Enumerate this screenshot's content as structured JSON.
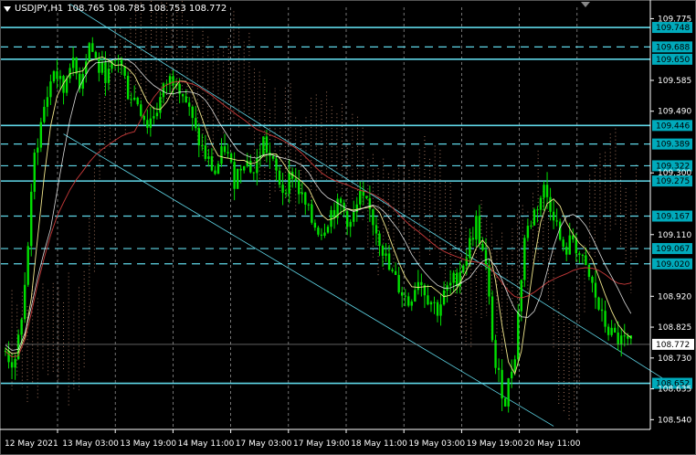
{
  "symbol_header": {
    "symbol": "USDJPY,H1",
    "ohlc": "108.765 108.785 108.753 108.772",
    "dropdown_icon": "triangle-down-icon"
  },
  "colors": {
    "background": "#000000",
    "candle": "#00e000",
    "level_line": "#5fd7e8",
    "level_label_bg": "#00aabb",
    "price_axis_text": "#ffffff",
    "grid": "#cfcfcf",
    "ma_white": "#ffffff",
    "ma_red": "#c83a3a",
    "ma_yellow": "#f0e68c",
    "cloud_dots": "#e0a080"
  },
  "price_axis": {
    "ticks": [
      "109.775",
      "109.585",
      "109.490",
      "109.300",
      "109.110",
      "108.920",
      "108.825",
      "108.730",
      "108.635",
      "108.540"
    ],
    "current_price": "108.772"
  },
  "levels": [
    {
      "price": "109.748",
      "style": "solid"
    },
    {
      "price": "109.688",
      "style": "dashed"
    },
    {
      "price": "109.650",
      "style": "solid"
    },
    {
      "price": "109.446",
      "style": "solid"
    },
    {
      "price": "109.389",
      "style": "dashed"
    },
    {
      "price": "109.322",
      "style": "dashed"
    },
    {
      "price": "109.275",
      "style": "solid"
    },
    {
      "price": "109.167",
      "style": "dashed"
    },
    {
      "price": "109.067",
      "style": "dashed"
    },
    {
      "price": "109.020",
      "style": "dashed"
    },
    {
      "price": "108.652",
      "style": "solid"
    }
  ],
  "time_axis": {
    "labels": [
      "12 May 2021",
      "13 May 03:00",
      "13 May 19:00",
      "14 May 11:00",
      "17 May 03:00",
      "17 May 19:00",
      "18 May 11:00",
      "19 May 03:00",
      "19 May 19:00",
      "20 May 11:00"
    ]
  },
  "chart_data": {
    "type": "candlestick",
    "title": "USDJPY,H1",
    "ylim": [
      108.51,
      109.81
    ],
    "horizontal_levels": [
      109.748,
      109.688,
      109.65,
      109.446,
      109.389,
      109.322,
      109.275,
      109.167,
      109.067,
      109.02,
      108.652
    ],
    "last_price": 108.772,
    "grid": true,
    "close_path": [
      [
        0,
        108.75
      ],
      [
        3,
        108.7
      ],
      [
        6,
        108.95
      ],
      [
        9,
        109.35
      ],
      [
        12,
        109.5
      ],
      [
        15,
        109.62
      ],
      [
        18,
        109.55
      ],
      [
        20,
        109.65
      ],
      [
        23,
        109.58
      ],
      [
        26,
        109.7
      ],
      [
        29,
        109.62
      ],
      [
        32,
        109.6
      ],
      [
        35,
        109.66
      ],
      [
        38,
        109.55
      ],
      [
        41,
        109.52
      ],
      [
        44,
        109.45
      ],
      [
        47,
        109.5
      ],
      [
        50,
        109.58
      ],
      [
        53,
        109.6
      ],
      [
        56,
        109.52
      ],
      [
        59,
        109.42
      ],
      [
        62,
        109.35
      ],
      [
        65,
        109.3
      ],
      [
        68,
        109.38
      ],
      [
        71,
        109.28
      ],
      [
        74,
        109.35
      ],
      [
        77,
        109.3
      ],
      [
        80,
        109.4
      ],
      [
        83,
        109.32
      ],
      [
        86,
        109.25
      ],
      [
        89,
        109.3
      ],
      [
        92,
        109.22
      ],
      [
        95,
        109.15
      ],
      [
        98,
        109.12
      ],
      [
        101,
        109.18
      ],
      [
        104,
        109.2
      ],
      [
        107,
        109.14
      ],
      [
        110,
        109.22
      ],
      [
        113,
        109.18
      ],
      [
        116,
        109.1
      ],
      [
        119,
        109.0
      ],
      [
        122,
        108.95
      ],
      [
        125,
        108.9
      ],
      [
        128,
        108.98
      ],
      [
        131,
        108.92
      ],
      [
        134,
        108.88
      ],
      [
        137,
        108.94
      ],
      [
        140,
        108.98
      ],
      [
        143,
        109.05
      ],
      [
        146,
        109.15
      ],
      [
        149,
        109.0
      ],
      [
        152,
        108.7
      ],
      [
        155,
        108.6
      ],
      [
        158,
        108.75
      ],
      [
        161,
        109.1
      ],
      [
        164,
        109.18
      ],
      [
        167,
        109.25
      ],
      [
        170,
        109.18
      ],
      [
        173,
        109.05
      ],
      [
        176,
        109.1
      ],
      [
        179,
        109.02
      ],
      [
        182,
        108.95
      ],
      [
        185,
        108.85
      ],
      [
        188,
        108.8
      ],
      [
        191,
        108.78
      ],
      [
        194,
        108.77
      ]
    ]
  }
}
